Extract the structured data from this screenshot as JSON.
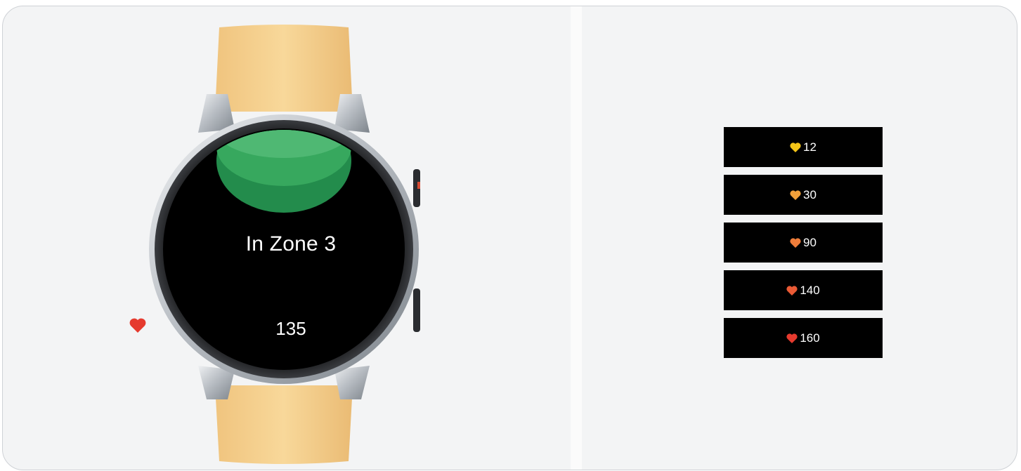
{
  "watch_screen": {
    "status_text": "In Zone 3",
    "heart_rate": "135",
    "heart_color": "#e53a2e",
    "zone_arc_colors": [
      "#4fb873",
      "#37a85e",
      "#238c4c"
    ]
  },
  "zone_list": {
    "items": [
      {
        "value": "12",
        "heart_color": "#f5c518"
      },
      {
        "value": "30",
        "heart_color": "#f2a03a"
      },
      {
        "value": "90",
        "heart_color": "#ef7d3a"
      },
      {
        "value": "140",
        "heart_color": "#ea5a35"
      },
      {
        "value": "160",
        "heart_color": "#e53a2e"
      }
    ]
  }
}
